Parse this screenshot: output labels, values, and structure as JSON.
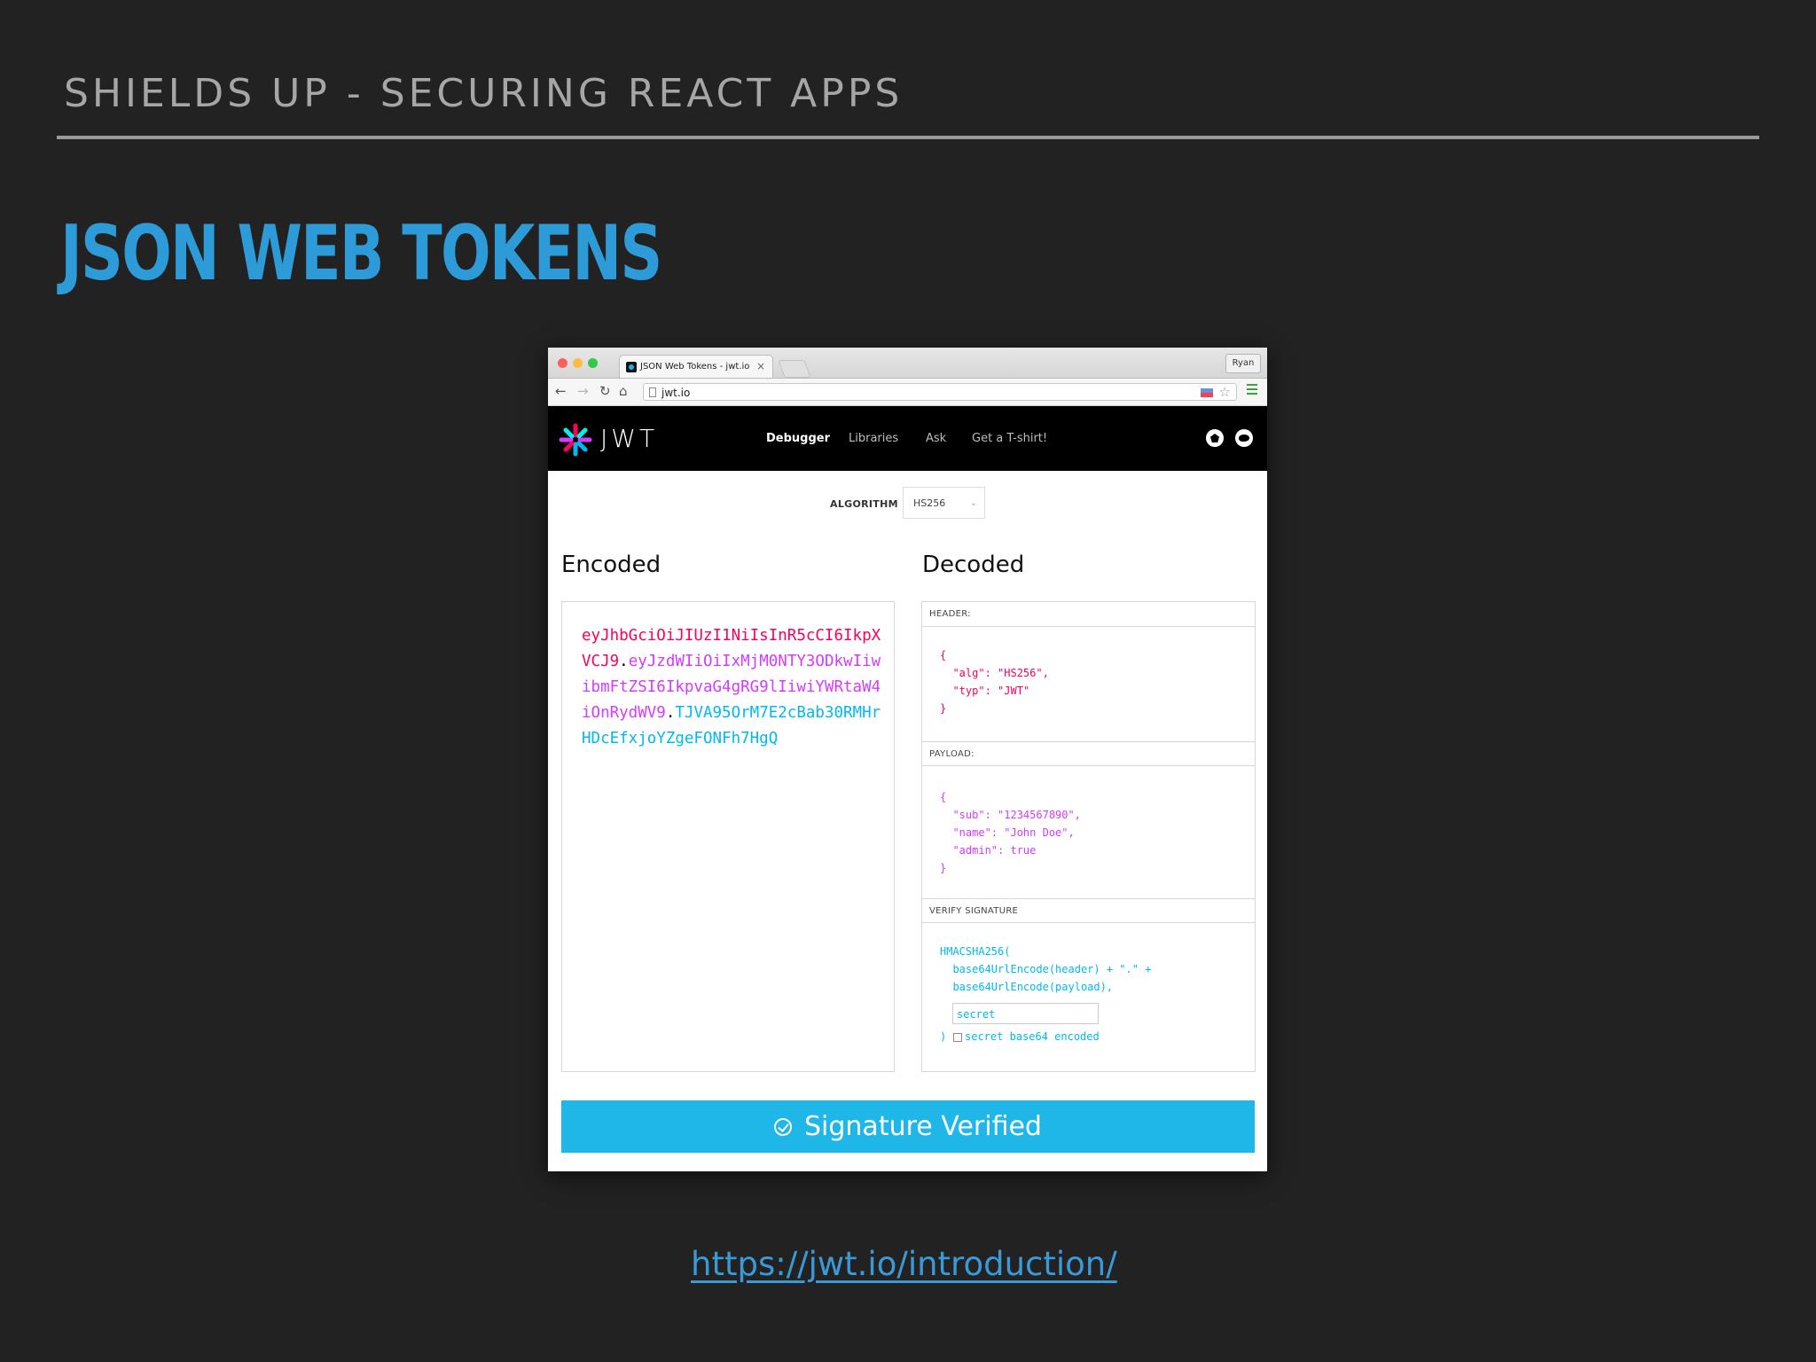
{
  "slide": {
    "header": "SHIELDS UP - SECURING REACT APPS",
    "title": "JSON WEB TOKENS",
    "link": "https://jwt.io/introduction/"
  },
  "browser": {
    "tab_title": "JSON Web Tokens - jwt.io",
    "tab_close": "×",
    "profile": "Ryan",
    "url": "jwt.io"
  },
  "site": {
    "logo": "JWT",
    "nav": {
      "debugger": "Debugger",
      "libraries": "Libraries",
      "ask": "Ask",
      "tshirt": "Get a T-shirt!"
    },
    "algorithm_label": "ALGORITHM",
    "algorithm_value": "HS256",
    "encoded_title": "Encoded",
    "decoded_title": "Decoded",
    "encoded": {
      "header": "eyJhbGciOiJIUzI1NiIsInR5cCI6IkpXVCJ9",
      "dot1": ".",
      "payload": "eyJzdWIiOiIxMjM0NTY3ODkwIiwibmFtZSI6IkpvaG4gRG9lIiwiYWRtaW4iOnRydWV9",
      "dot2": ".",
      "signature": "TJVA95OrM7E2cBab30RMHrHDcEfxjoYZgeFONFh7HgQ"
    },
    "decoded": {
      "header_label": "HEADER:",
      "header_json": "{\n  \"alg\": \"HS256\",\n  \"typ\": \"JWT\"\n}",
      "payload_label": "PAYLOAD:",
      "payload_json": "{\n  \"sub\": \"1234567890\",\n  \"name\": \"John Doe\",\n  \"admin\": true\n}",
      "verify_label": "VERIFY SIGNATURE",
      "verify_code": "HMACSHA256(\n  base64UrlEncode(header) + \".\" +\n  base64UrlEncode(payload),",
      "secret_value": "secret",
      "verify_close": ") ",
      "base64_label": "secret base64 encoded"
    },
    "verified_label": "Signature Verified"
  },
  "colors": {
    "title_blue": "#2d9bd8",
    "header_red": "#fb015b",
    "payload_purple": "#d63aff",
    "signature_blue": "#00b9f1",
    "verified_bar": "#1fb7e8"
  }
}
